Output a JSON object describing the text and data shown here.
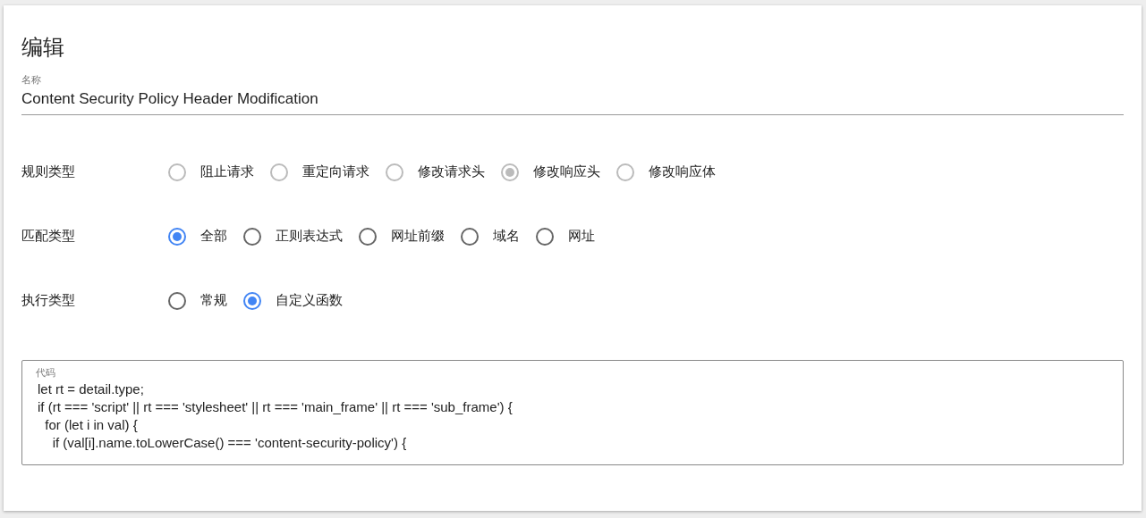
{
  "title": "编辑",
  "name_field": {
    "label": "名称",
    "value": "Content Security Policy Header Modification"
  },
  "groups": [
    {
      "label": "规则类型",
      "disabled": true,
      "options": [
        {
          "label": "阻止请求",
          "selected": false
        },
        {
          "label": "重定向请求",
          "selected": false
        },
        {
          "label": "修改请求头",
          "selected": false
        },
        {
          "label": "修改响应头",
          "selected": true
        },
        {
          "label": "修改响应体",
          "selected": false
        }
      ]
    },
    {
      "label": "匹配类型",
      "disabled": false,
      "options": [
        {
          "label": "全部",
          "selected": true
        },
        {
          "label": "正则表达式",
          "selected": false
        },
        {
          "label": "网址前缀",
          "selected": false
        },
        {
          "label": "域名",
          "selected": false
        },
        {
          "label": "网址",
          "selected": false
        }
      ]
    },
    {
      "label": "执行类型",
      "disabled": false,
      "options": [
        {
          "label": "常规",
          "selected": false
        },
        {
          "label": "自定义函数",
          "selected": true
        }
      ]
    }
  ],
  "code_field": {
    "label": "代码",
    "lines": [
      "let rt = detail.type;",
      "if (rt === 'script' || rt === 'stylesheet' || rt === 'main_frame' || rt === 'sub_frame') {",
      "  for (let i in val) {",
      "    if (val[i].name.toLowerCase() === 'content-security-policy') {"
    ]
  }
}
